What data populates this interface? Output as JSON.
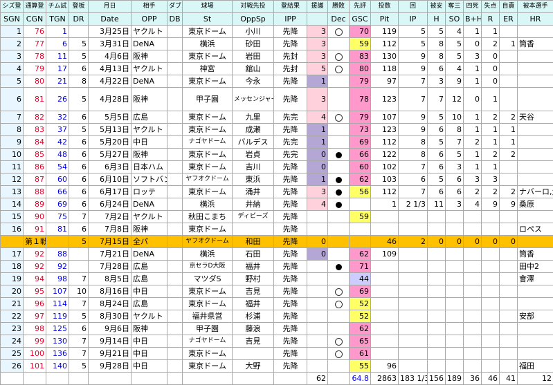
{
  "header_jp": [
    "シズ登",
    "通算登",
    "チム試",
    "登板",
    "月日",
    "相手",
    "ダブル",
    "球場",
    "対戦先投",
    "登結果",
    "援護",
    "勝敗",
    "先評",
    "投数",
    "回",
    "被安",
    "奪三",
    "四死",
    "失点",
    "自責",
    "被本選手"
  ],
  "header_en": [
    "SGN",
    "CGN",
    "TGN",
    "DR",
    "Date",
    "OPP",
    "DB",
    "St",
    "OppSp",
    "IPP",
    "",
    "Dec",
    "GSC",
    "Pit",
    "IP",
    "H",
    "SO",
    "B+H",
    "R",
    "ER",
    "HR"
  ],
  "rows": [
    {
      "sgn": "1",
      "cgn": "76",
      "tgn": "1",
      "dr": "",
      "date": "3月25日",
      "opp": "ヤクルト",
      "db": "",
      "st": "東京ドーム",
      "oppsp": "小川",
      "ipp": "先降",
      "sup": "3",
      "dec": "ring",
      "gsc": "70",
      "pit": "119",
      "ip": "5",
      "h": "5",
      "so": "4",
      "bh": "1",
      "r": "1",
      "er": "",
      "hr": ""
    },
    {
      "sgn": "2",
      "cgn": "77",
      "tgn": "6",
      "dr": "5",
      "date": "3月31日",
      "opp": "DeNA",
      "db": "",
      "st": "横浜",
      "oppsp": "砂田",
      "ipp": "先降",
      "sup": "3",
      "dec": "",
      "gsc": "59",
      "pit": "112",
      "ip": "5",
      "h": "8",
      "so": "5",
      "bh": "0",
      "r": "2",
      "er": "1",
      "hr": "筒香"
    },
    {
      "sgn": "3",
      "cgn": "78",
      "tgn": "11",
      "dr": "5",
      "date": "4月6日",
      "opp": "阪神",
      "db": "",
      "st": "東京ドーム",
      "oppsp": "岩田",
      "ipp": "先封",
      "sup": "3",
      "dec": "ring",
      "gsc": "83",
      "pit": "130",
      "ip": "9",
      "h": "8",
      "so": "5",
      "bh": "3",
      "r": "0",
      "er": "",
      "hr": ""
    },
    {
      "sgn": "4",
      "cgn": "79",
      "tgn": "17",
      "dr": "6",
      "date": "4月13日",
      "opp": "ヤクルト",
      "db": "",
      "st": "神宮",
      "oppsp": "舘山",
      "ipp": "先封",
      "sup": "5",
      "dec": "ring",
      "gsc": "80",
      "pit": "118",
      "ip": "9",
      "h": "6",
      "so": "4",
      "bh": "1",
      "r": "0",
      "er": "",
      "hr": ""
    },
    {
      "sgn": "5",
      "cgn": "80",
      "tgn": "21",
      "dr": "8",
      "date": "4月22日",
      "opp": "DeNA",
      "db": "",
      "st": "東京ドーム",
      "oppsp": "今永",
      "ipp": "先降",
      "sup": "1",
      "dec": "",
      "gsc": "79",
      "pit": "97",
      "ip": "7",
      "h": "3",
      "so": "9",
      "bh": "1",
      "r": "0",
      "er": "",
      "hr": ""
    },
    {
      "sgn": "6",
      "cgn": "81",
      "tgn": "26",
      "dr": "5",
      "date": "4月28日",
      "opp": "阪神",
      "db": "",
      "st": "甲子園",
      "oppsp": "メッセンジャー",
      "ipp": "先降",
      "sup": "3",
      "dec": "",
      "gsc": "78",
      "pit": "123",
      "ip": "7",
      "h": "7",
      "so": "12",
      "bh": "0",
      "r": "1",
      "er": "",
      "hr": "",
      "tall": true
    },
    {
      "sgn": "7",
      "cgn": "82",
      "tgn": "32",
      "dr": "6",
      "date": "5月5日",
      "opp": "広島",
      "db": "",
      "st": "東京ドーム",
      "oppsp": "九里",
      "ipp": "先完",
      "sup": "4",
      "dec": "ring",
      "gsc": "79",
      "pit": "107",
      "ip": "9",
      "h": "5",
      "so": "10",
      "bh": "1",
      "r": "2",
      "er": "2",
      "hr": "天谷"
    },
    {
      "sgn": "8",
      "cgn": "83",
      "tgn": "37",
      "dr": "5",
      "date": "5月13日",
      "opp": "ヤクルト",
      "db": "",
      "st": "東京ドーム",
      "oppsp": "成瀬",
      "ipp": "先降",
      "sup": "1",
      "dec": "",
      "gsc": "73",
      "pit": "123",
      "ip": "9",
      "h": "6",
      "so": "8",
      "bh": "1",
      "r": "1",
      "er": "1",
      "hr": ""
    },
    {
      "sgn": "9",
      "cgn": "84",
      "tgn": "42",
      "dr": "6",
      "date": "5月20日",
      "opp": "中日",
      "db": "",
      "st": "ナゴヤドーム",
      "oppsp": "バルデス",
      "ipp": "先完",
      "sup": "1",
      "dec": "",
      "gsc": "69",
      "pit": "112",
      "ip": "8",
      "h": "5",
      "so": "7",
      "bh": "2",
      "r": "1",
      "er": "1",
      "hr": ""
    },
    {
      "sgn": "10",
      "cgn": "85",
      "tgn": "48",
      "dr": "6",
      "date": "5月27日",
      "opp": "阪神",
      "db": "",
      "st": "東京ドーム",
      "oppsp": "岩貞",
      "ipp": "先完",
      "sup": "0",
      "dec": "dot",
      "gsc": "66",
      "pit": "122",
      "ip": "8",
      "h": "6",
      "so": "5",
      "bh": "1",
      "r": "2",
      "er": "2",
      "hr": ""
    },
    {
      "sgn": "11",
      "cgn": "86",
      "tgn": "54",
      "dr": "6",
      "date": "6月3日",
      "opp": "日本ハム",
      "db": "",
      "st": "東京ドーム",
      "oppsp": "吉川",
      "ipp": "先降",
      "sup": "0",
      "dec": "",
      "gsc": "60",
      "pit": "102",
      "ip": "7",
      "h": "6",
      "so": "3",
      "bh": "1",
      "r": "1",
      "er": "",
      "hr": ""
    },
    {
      "sgn": "12",
      "cgn": "87",
      "tgn": "60",
      "dr": "6",
      "date": "6月10日",
      "opp": "ソフトバンク",
      "db": "",
      "st": "ヤフオクドーム",
      "oppsp": "東浜",
      "ipp": "先降",
      "sup": "1",
      "dec": "dot",
      "gsc": "62",
      "pit": "103",
      "ip": "6",
      "h": "5",
      "so": "6",
      "bh": "3",
      "r": "3",
      "er": "",
      "hr": ""
    },
    {
      "sgn": "13",
      "cgn": "88",
      "tgn": "66",
      "dr": "6",
      "date": "6月17日",
      "opp": "ロッテ",
      "db": "",
      "st": "東京ドーム",
      "oppsp": "涌井",
      "ipp": "先降",
      "sup": "3",
      "dec": "dot",
      "gsc": "56",
      "pit": "112",
      "ip": "7",
      "h": "6",
      "so": "6",
      "bh": "2",
      "r": "2",
      "er": "2",
      "hr": "ナバーロ,角中"
    },
    {
      "sgn": "14",
      "cgn": "89",
      "tgn": "69",
      "dr": "6",
      "date": "6月24日",
      "opp": "DeNA",
      "db": "",
      "st": "横浜",
      "oppsp": "井納",
      "ipp": "先降",
      "sup": "4",
      "dec": "dot",
      "gsc": "",
      "pit": "1",
      "ip": "2 1/3",
      "h": "11",
      "so": "3",
      "bh": "4",
      "r": "9",
      "er": "9",
      "hr": "桑原"
    },
    {
      "sgn": "15",
      "cgn": "90",
      "tgn": "75",
      "dr": "7",
      "date": "7月2日",
      "opp": "ヤクルト",
      "db": "",
      "st": "秋田こまち",
      "oppsp": "ディビーズ",
      "ipp": "先降",
      "sup": "",
      "dec": "",
      "gsc": "59",
      "pit": "",
      "ip": "",
      "h": "",
      "so": "",
      "bh": "",
      "r": "",
      "er": "",
      "hr": ""
    },
    {
      "sgn": "16",
      "cgn": "91",
      "tgn": "81",
      "dr": "6",
      "date": "7月8日",
      "opp": "阪神",
      "db": "",
      "st": "東京ドーム",
      "oppsp": "",
      "ipp": "先降",
      "sup": "",
      "dec": "",
      "gsc": "",
      "pit": "",
      "ip": "",
      "h": "",
      "so": "",
      "bh": "",
      "r": "",
      "er": "",
      "hr": "ロペス"
    },
    {
      "sgn": "",
      "cgn": "第１戦",
      "tgn": "",
      "dr": "5",
      "date": "7月15日",
      "opp": "全パ",
      "db": "",
      "st": "ヤフオクドーム",
      "oppsp": "和田",
      "ipp": "先降",
      "sup": "0",
      "dec": "",
      "gsc": "",
      "pit": "46",
      "ip": "2",
      "h": "0",
      "so": "0",
      "bh": "0",
      "r": "0",
      "er": "0",
      "hr": "",
      "highlight": true
    },
    {
      "sgn": "17",
      "cgn": "92",
      "tgn": "88",
      "dr": "",
      "date": "7月21日",
      "opp": "DeNA",
      "db": "",
      "st": "横浜",
      "oppsp": "石田",
      "ipp": "先降",
      "sup": "0",
      "dec": "",
      "gsc": "62",
      "pit": "109",
      "ip": "",
      "h": "",
      "so": "",
      "bh": "",
      "r": "",
      "er": "",
      "hr": "筒香"
    },
    {
      "sgn": "18",
      "cgn": "92",
      "tgn": "92",
      "dr": "",
      "date": "7月28日",
      "opp": "広島",
      "db": "",
      "st": "京セラD大阪",
      "oppsp": "福井",
      "ipp": "先降",
      "sup": "",
      "dec": "dot",
      "gsc": "71",
      "pit": "",
      "ip": "",
      "h": "",
      "so": "",
      "bh": "",
      "r": "",
      "er": "",
      "hr": "田中2"
    },
    {
      "sgn": "19",
      "cgn": "94",
      "tgn": "98",
      "dr": "7",
      "date": "8月5日",
      "opp": "広島",
      "db": "",
      "st": "マツダS",
      "oppsp": "野村",
      "ipp": "先降",
      "sup": "",
      "dec": "",
      "gsc": "44",
      "pit": "",
      "ip": "",
      "h": "",
      "so": "",
      "bh": "",
      "r": "",
      "er": "",
      "hr": "會澤"
    },
    {
      "sgn": "20",
      "cgn": "95",
      "tgn": "107",
      "dr": "10",
      "date": "8月16日",
      "opp": "中日",
      "db": "",
      "st": "東京ドーム",
      "oppsp": "吉見",
      "ipp": "先降",
      "sup": "",
      "dec": "ring",
      "gsc": "69",
      "pit": "",
      "ip": "",
      "h": "",
      "so": "",
      "bh": "",
      "r": "",
      "er": "",
      "hr": ""
    },
    {
      "sgn": "21",
      "cgn": "96",
      "tgn": "114",
      "dr": "7",
      "date": "8月24日",
      "opp": "広島",
      "db": "",
      "st": "東京ドーム",
      "oppsp": "福井",
      "ipp": "先降",
      "sup": "",
      "dec": "ring",
      "gsc": "52",
      "pit": "",
      "ip": "",
      "h": "",
      "so": "",
      "bh": "",
      "r": "",
      "er": "",
      "hr": ""
    },
    {
      "sgn": "22",
      "cgn": "97",
      "tgn": "119",
      "dr": "5",
      "date": "8月30日",
      "opp": "ヤクルト",
      "db": "",
      "st": "福井県営",
      "oppsp": "杉浦",
      "ipp": "先降",
      "sup": "",
      "dec": "",
      "gsc": "52",
      "pit": "",
      "ip": "",
      "h": "",
      "so": "",
      "bh": "",
      "r": "",
      "er": "",
      "hr": "安部"
    },
    {
      "sgn": "23",
      "cgn": "98",
      "tgn": "125",
      "dr": "6",
      "date": "9月6日",
      "opp": "阪神",
      "db": "",
      "st": "甲子園",
      "oppsp": "藤浪",
      "ipp": "先降",
      "sup": "",
      "dec": "",
      "gsc": "62",
      "pit": "",
      "ip": "",
      "h": "",
      "so": "",
      "bh": "",
      "r": "",
      "er": "",
      "hr": ""
    },
    {
      "sgn": "24",
      "cgn": "99",
      "tgn": "130",
      "dr": "7",
      "date": "9月14日",
      "opp": "中日",
      "db": "",
      "st": "ナゴヤドーム",
      "oppsp": "吉見",
      "ipp": "先降",
      "sup": "",
      "dec": "ring",
      "gsc": "65",
      "pit": "",
      "ip": "",
      "h": "",
      "so": "",
      "bh": "",
      "r": "",
      "er": "",
      "hr": ""
    },
    {
      "sgn": "25",
      "cgn": "100",
      "tgn": "136",
      "dr": "7",
      "date": "9月21日",
      "opp": "中日",
      "db": "",
      "st": "東京ドーム",
      "oppsp": "",
      "ipp": "先降",
      "sup": "",
      "dec": "ring",
      "gsc": "61",
      "pit": "",
      "ip": "",
      "h": "",
      "so": "",
      "bh": "",
      "r": "",
      "er": "",
      "hr": ""
    },
    {
      "sgn": "26",
      "cgn": "101",
      "tgn": "140",
      "dr": "5",
      "date": "9月28日",
      "opp": "中日",
      "db": "",
      "st": "東京ドーム",
      "oppsp": "大野",
      "ipp": "先降",
      "sup": "",
      "dec": "",
      "gsc": "55",
      "pit": "96",
      "ip": "",
      "h": "",
      "so": "",
      "bh": "",
      "r": "",
      "er": "",
      "hr": "福田"
    }
  ],
  "totals": {
    "sup": "62",
    "gsc": "64.8",
    "pit": "2863",
    "ip": "183 1/3",
    "h": "156",
    "so": "189",
    "bh": "36",
    "r": "46",
    "er": "41",
    "hr": "12"
  },
  "colors": {
    "gsc_pink": "#ff99cc",
    "gsc_lavender": "#ccccff",
    "gsc_yellow": "#ffff66",
    "orange": "#ffc000",
    "sup_lavender": "#b4a7d6",
    "sup_pink": "#ffd1dc",
    "header_bg": "#d9f7f7"
  }
}
